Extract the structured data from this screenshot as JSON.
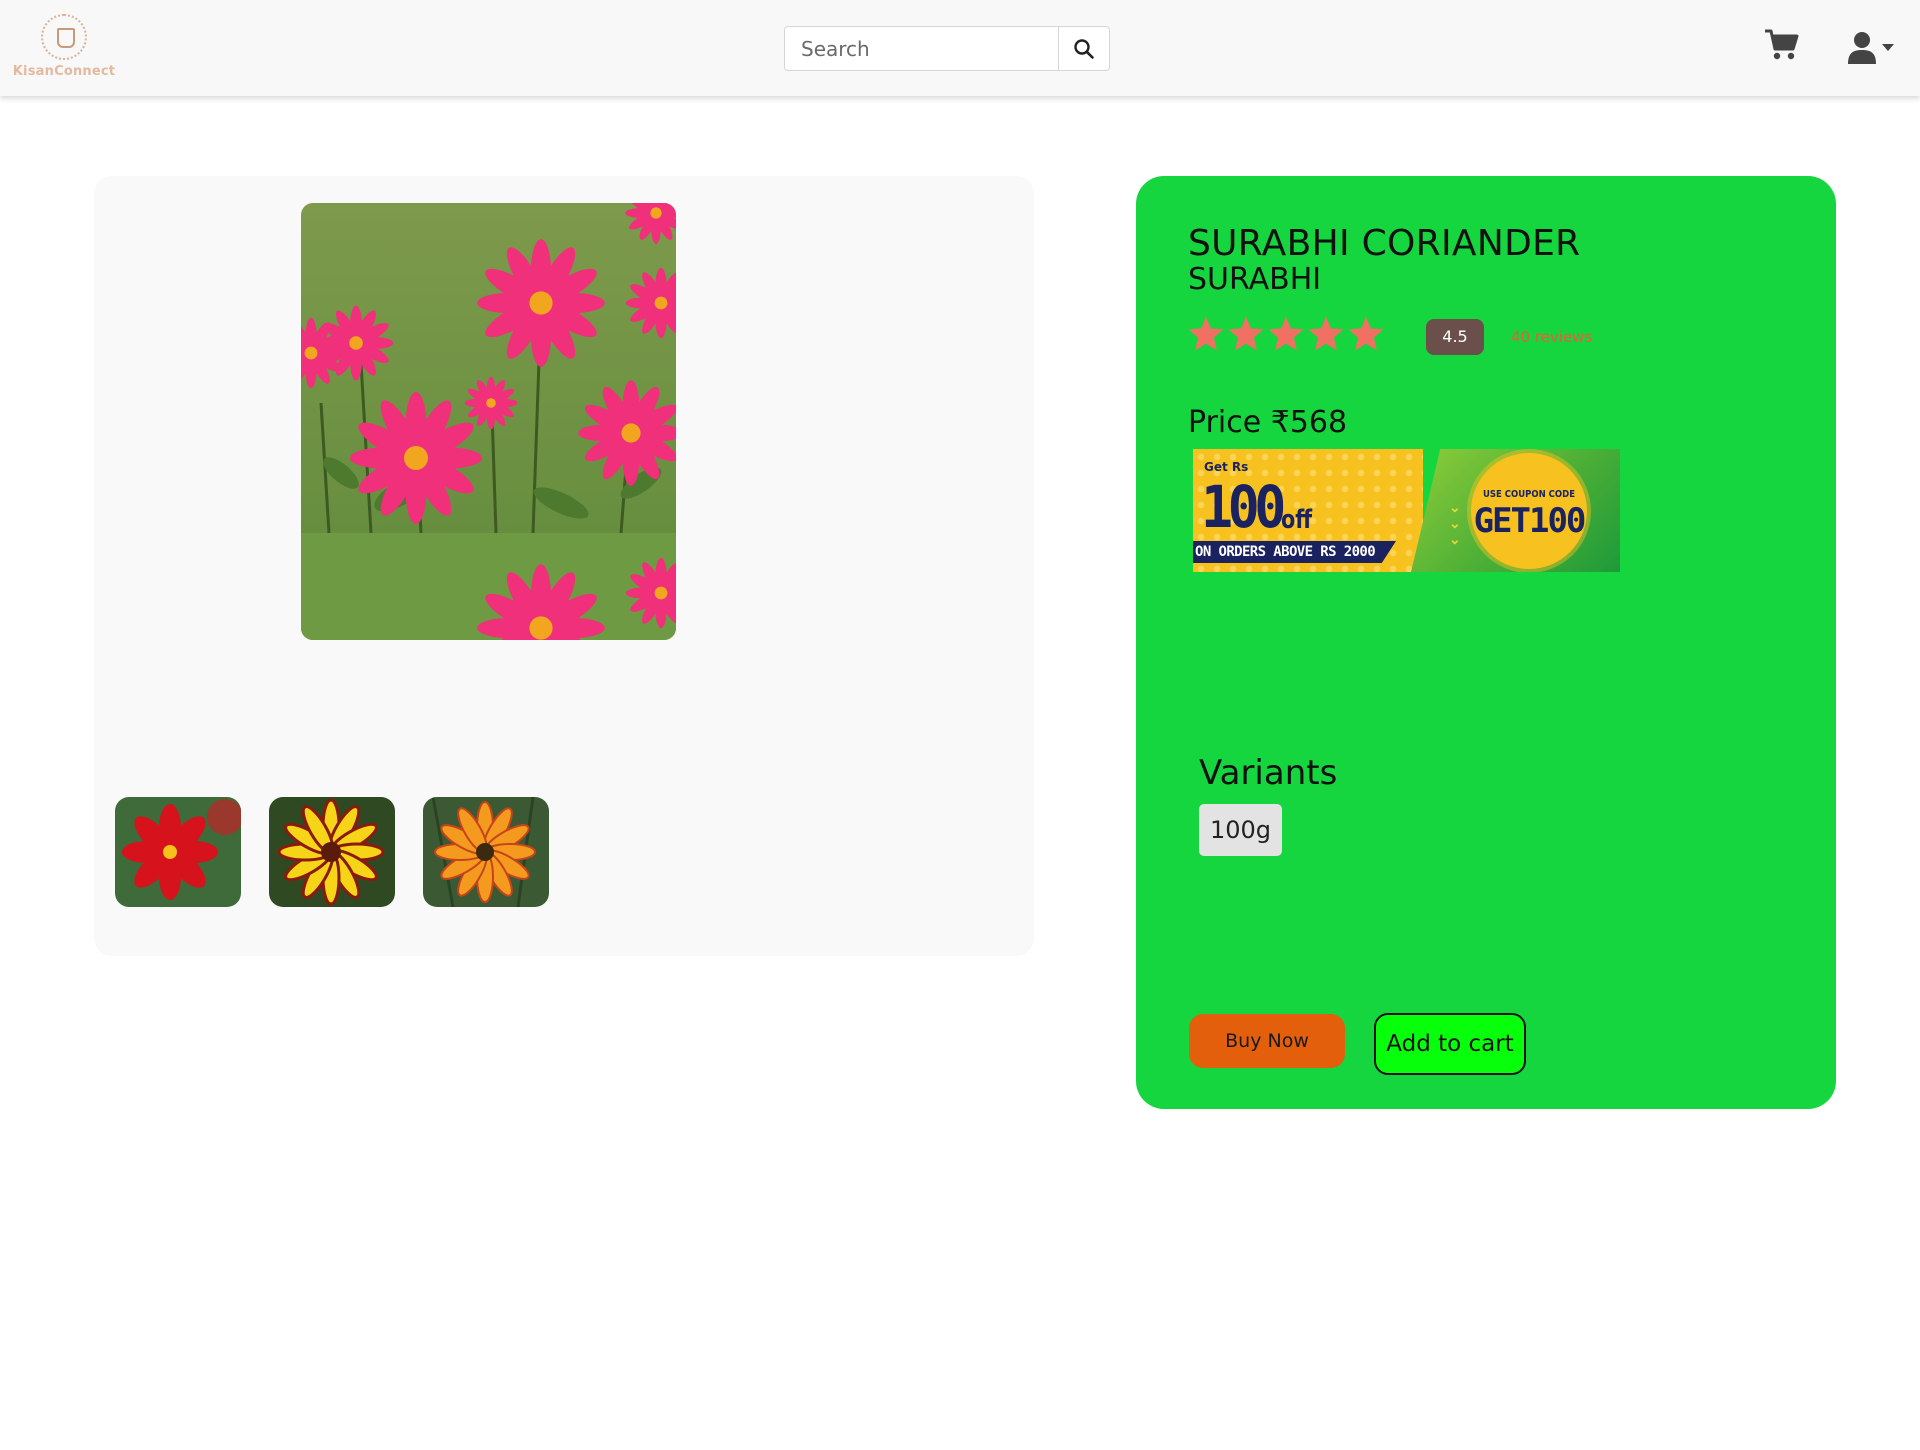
{
  "brand": {
    "name": "KisanConnect"
  },
  "search": {
    "placeholder": "Search"
  },
  "product": {
    "name": "SURABHI CORIANDER",
    "brand": "SURABHI",
    "rating": "4.5",
    "rating_stars": 5,
    "reviews_text": "40 reviews",
    "price_text": "Price ₹568"
  },
  "coupon": {
    "get_text": "Get Rs",
    "amount": "100",
    "off_text": "off",
    "condition": "ON ORDERS ABOVE RS 2000",
    "use_text": "USE COUPON CODE",
    "code": "GET100"
  },
  "variants": {
    "title": "Variants",
    "options": [
      "100g"
    ]
  },
  "actions": {
    "buy_now": "Buy Now",
    "add_to_cart": "Add to cart"
  },
  "colors": {
    "card_bg": "#15d63e",
    "star": "#f07163",
    "buy_now_bg": "#e35f0c",
    "add_to_cart_bg": "#08ff0b",
    "rating_badge": "#6b4f4a",
    "reviews": "#e85d3c"
  },
  "icons": [
    "search-icon",
    "cart-icon",
    "user-icon",
    "caret-down-icon",
    "star-icon"
  ]
}
